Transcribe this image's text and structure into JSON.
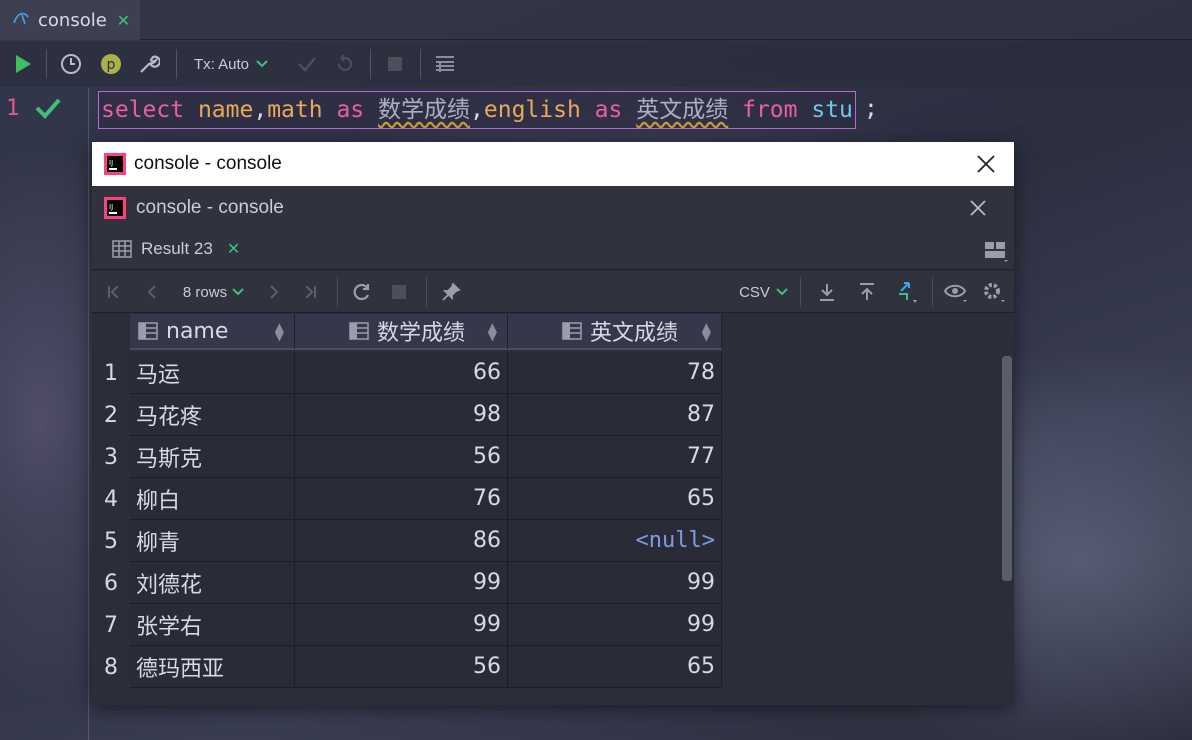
{
  "editor": {
    "tab_label": "console",
    "toolbar": {
      "tx_label": "Tx: Auto"
    },
    "line_number": "1",
    "query": {
      "kw_select": "select",
      "col_name": "name",
      "comma1": ",",
      "col_math": "math",
      "kw_as1": "as",
      "alias_math": "数学成绩",
      "comma2": ",",
      "col_english": "english",
      "kw_as2": "as",
      "alias_english": "英文成绩",
      "kw_from": "from",
      "table": "stu",
      "semicolon": ";"
    }
  },
  "popup": {
    "window_title": "console - console",
    "inner_title": "console - console",
    "result_tab": "Result 23",
    "rows_label": "8 rows",
    "export_format": "CSV"
  },
  "grid": {
    "columns": [
      "name",
      "数学成绩",
      "英文成绩"
    ],
    "rows": [
      {
        "num": "1",
        "name": "马运",
        "math": "66",
        "english": "78"
      },
      {
        "num": "2",
        "name": "马花疼",
        "math": "98",
        "english": "87"
      },
      {
        "num": "3",
        "name": "马斯克",
        "math": "56",
        "english": "77"
      },
      {
        "num": "4",
        "name": "柳白",
        "math": "76",
        "english": "65"
      },
      {
        "num": "5",
        "name": "柳青",
        "math": "86",
        "english": "<null>"
      },
      {
        "num": "6",
        "name": "刘德花",
        "math": "99",
        "english": "99"
      },
      {
        "num": "7",
        "name": "张学右",
        "math": "99",
        "english": "99"
      },
      {
        "num": "8",
        "name": "德玛西亚",
        "math": "56",
        "english": "65"
      }
    ]
  },
  "colors": {
    "keyword": "#ea5fa0",
    "identifier": "#e8a95b",
    "table_name": "#6fc6e8",
    "null_value": "#7f9be0",
    "success_green": "#3fbf7f",
    "selection_border": "#b56ad8"
  }
}
